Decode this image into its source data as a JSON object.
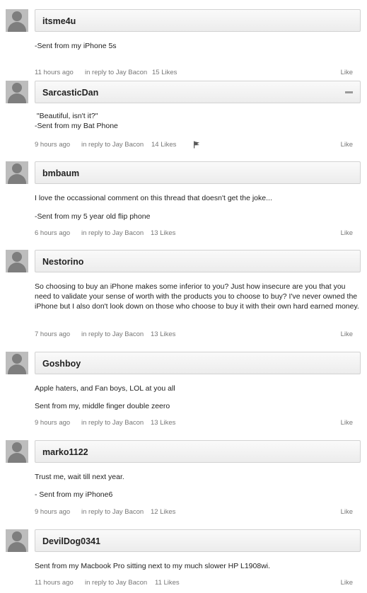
{
  "comments": [
    {
      "author": "itsme4u",
      "body": [
        "-Sent from my iPhone 5s"
      ],
      "time": "11 hours ago",
      "reply": "in reply to Jay Bacon",
      "likes": "15 Likes",
      "like_label": "Like",
      "collapse_icon": false,
      "flag_icon": false
    },
    {
      "author": "SarcasticDan",
      "body": [
        " \"Beautiful, isn't it?\"\n-Sent from my Bat Phone"
      ],
      "time": "9 hours ago",
      "reply": "in reply to Jay Bacon",
      "likes": "14 Likes",
      "like_label": "Like",
      "collapse_icon": true,
      "flag_icon": true
    },
    {
      "author": "bmbaum",
      "body": [
        "I love the occassional comment on this thread that doesn't get the joke...",
        "-Sent from my 5 year old flip phone"
      ],
      "time": "6 hours ago",
      "reply": "in reply to Jay Bacon",
      "likes": "13 Likes",
      "like_label": "Like",
      "collapse_icon": false,
      "flag_icon": false
    },
    {
      "author": "Nestorino",
      "body": [
        "So choosing to buy an iPhone makes some inferior to you? Just how insecure are you that you need to validate your sense of worth with the products you to choose to buy? I've never owned the iPhone but I also don't look down on those who choose to buy it with their own hard earned money."
      ],
      "time": "7 hours ago",
      "reply": "in reply to Jay Bacon",
      "likes": "13 Likes",
      "like_label": "Like",
      "collapse_icon": false,
      "flag_icon": false
    },
    {
      "author": "Goshboy",
      "body": [
        "Apple haters, and Fan boys, LOL at you all",
        "Sent from my, middle finger double zeero"
      ],
      "time": "9 hours ago",
      "reply": "in reply to Jay Bacon",
      "likes": "13 Likes",
      "like_label": "Like",
      "collapse_icon": false,
      "flag_icon": false
    },
    {
      "author": "marko1122",
      "body": [
        "Trust me, wait till next year.",
        "- Sent from my iPhone6"
      ],
      "time": "9 hours ago",
      "reply": "in reply to Jay Bacon",
      "likes": "12 Likes",
      "like_label": "Like",
      "collapse_icon": false,
      "flag_icon": false
    },
    {
      "author": "DevilDog0341",
      "body": [
        "Sent from my Macbook Pro sitting next to my much slower HP L1908wi."
      ],
      "time": "11 hours ago",
      "reply": "in reply to Jay Bacon",
      "likes": "11 Likes",
      "like_label": "Like",
      "collapse_icon": false,
      "flag_icon": false
    }
  ]
}
